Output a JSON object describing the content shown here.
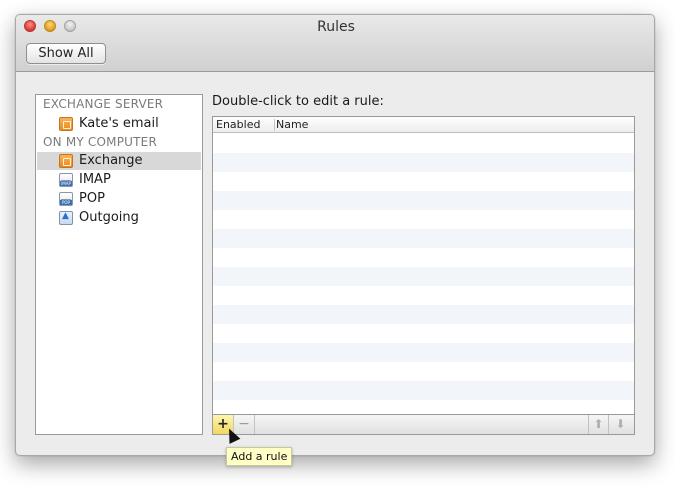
{
  "window": {
    "title": "Rules"
  },
  "toolbar": {
    "show_all_label": "Show All"
  },
  "sidebar": {
    "sections": [
      {
        "header": "EXCHANGE SERVER",
        "items": [
          {
            "label": "Kate's email",
            "icon": "exchange-icon"
          }
        ]
      },
      {
        "header": "ON MY COMPUTER",
        "items": [
          {
            "label": "Exchange",
            "icon": "exchange-icon",
            "selected": true
          },
          {
            "label": "IMAP",
            "icon": "imap-icon"
          },
          {
            "label": "POP",
            "icon": "pop-icon"
          },
          {
            "label": "Outgoing",
            "icon": "outgoing-icon"
          }
        ]
      }
    ]
  },
  "main": {
    "instruction": "Double-click to edit a rule:",
    "table": {
      "columns": [
        "Enabled",
        "Name"
      ],
      "rows": []
    }
  },
  "table_toolbar": {
    "add_glyph": "+",
    "remove_glyph": "−",
    "move_up_glyph": "⬆",
    "move_down_glyph": "⬇"
  },
  "tooltip": "Add a rule",
  "icons": {
    "mail_tag_imap": "IMAP",
    "mail_tag_pop": "POP"
  }
}
